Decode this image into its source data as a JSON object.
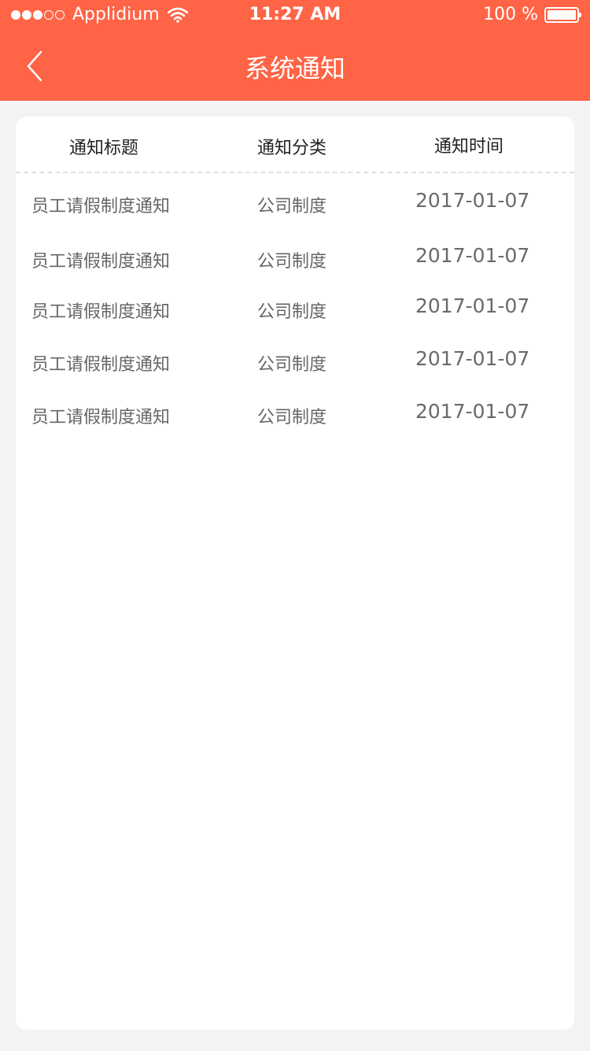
{
  "status_bar": {
    "carrier": "Applidium",
    "time": "11:27 AM",
    "battery": "100 %",
    "signal_bars": 3,
    "icons": [
      "signal-dots-icon",
      "wifi-icon",
      "battery-icon"
    ]
  },
  "nav": {
    "title": "系统通知",
    "back_icon": "chevron-left-icon"
  },
  "colors": {
    "header": "#ff6446",
    "background": "#f3f3f3",
    "card": "#ffffff"
  },
  "table": {
    "headers": [
      "通知标题",
      "通知分类",
      "通知时间"
    ],
    "rows": [
      {
        "title": "员工请假制度通知",
        "category": "公司制度",
        "time": "2017-01-07"
      },
      {
        "title": "员工请假制度通知",
        "category": "公司制度",
        "time": "2017-01-07"
      },
      {
        "title": "员工请假制度通知",
        "category": "公司制度",
        "time": "2017-01-07"
      },
      {
        "title": "员工请假制度通知",
        "category": "公司制度",
        "time": "2017-01-07"
      },
      {
        "title": "员工请假制度通知",
        "category": "公司制度",
        "time": "2017-01-07"
      }
    ]
  }
}
